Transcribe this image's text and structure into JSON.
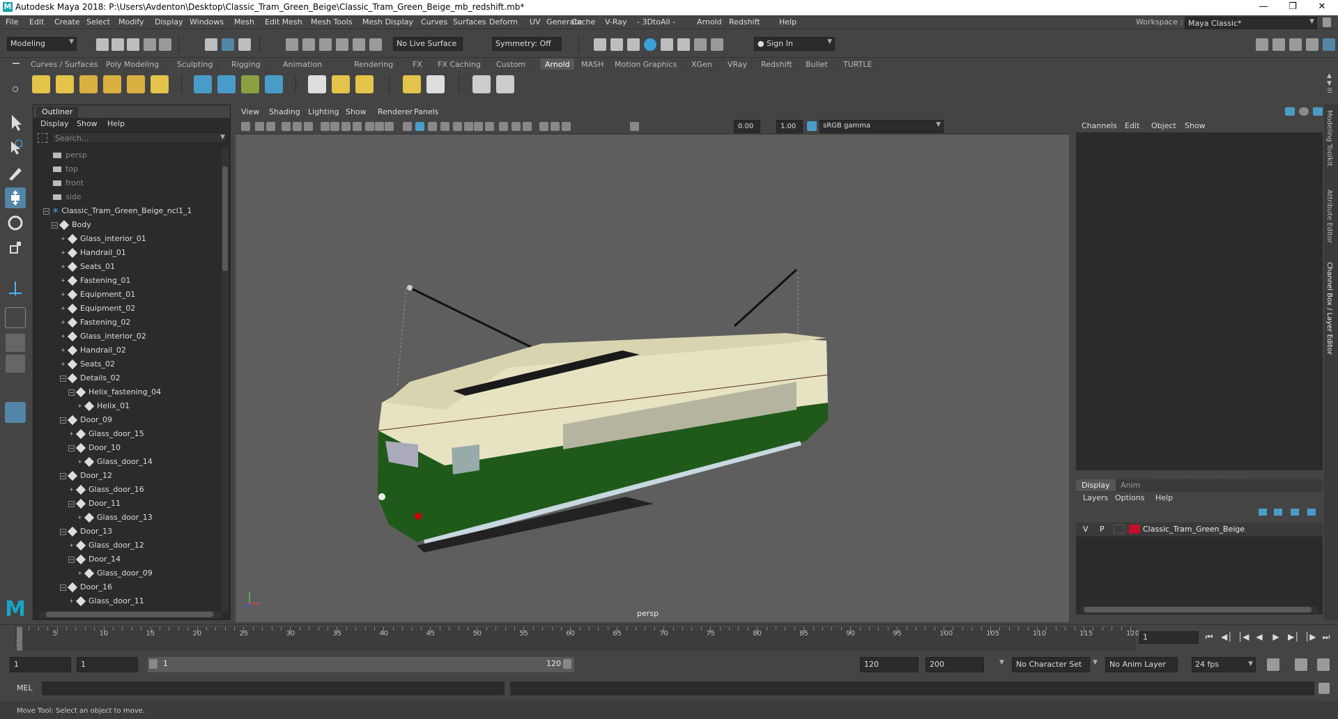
{
  "window": {
    "title": "Autodesk Maya 2018: P:\\Users\\Avdenton\\Desktop\\Classic_Tram_Green_Beige\\Classic_Tram_Green_Beige_mb_redshift.mb*",
    "logo": "M"
  },
  "menus": [
    "File",
    "Edit",
    "Create",
    "Select",
    "Modify",
    "Display",
    "Windows",
    "Mesh",
    "Edit Mesh",
    "Mesh Tools",
    "Mesh Display",
    "Curves",
    "Surfaces",
    "Deform",
    "UV",
    "Generate",
    "Cache",
    "V-Ray",
    "- 3DtoAll -",
    "Arnold",
    "Redshift",
    "Help"
  ],
  "workspace": {
    "label": "Workspace :",
    "value": "Maya Classic*"
  },
  "status": {
    "mode": "Modeling",
    "live_surface": "No Live Surface",
    "symmetry": "Symmetry: Off",
    "sign_in": "Sign In"
  },
  "shelf_tabs": [
    "Curves / Surfaces",
    "Poly Modeling",
    "Sculpting",
    "Rigging",
    "Animation",
    "Rendering",
    "FX",
    "FX Caching",
    "Custom",
    "Arnold",
    "MASH",
    "Motion Graphics",
    "XGen",
    "VRay",
    "Redshift",
    "Bullet",
    "TURTLE"
  ],
  "shelf_active": "Arnold",
  "outliner": {
    "tab": "Outliner",
    "menus": [
      "Display",
      "Show",
      "Help"
    ],
    "search_placeholder": "Search...",
    "rows": [
      {
        "label": "persp",
        "depth": 0,
        "kind": "cam",
        "dim": true
      },
      {
        "label": "top",
        "depth": 0,
        "kind": "cam",
        "dim": true
      },
      {
        "label": "front",
        "depth": 0,
        "kind": "cam",
        "dim": true
      },
      {
        "label": "side",
        "depth": 0,
        "kind": "cam",
        "dim": true
      },
      {
        "label": "Classic_Tram_Green_Beige_ncl1_1",
        "depth": 0,
        "kind": "grp",
        "exp": true
      },
      {
        "label": "Body",
        "depth": 1,
        "kind": "mesh",
        "exp": true
      },
      {
        "label": "Glass_interior_01",
        "depth": 2,
        "kind": "mesh"
      },
      {
        "label": "Handrail_01",
        "depth": 2,
        "kind": "mesh"
      },
      {
        "label": "Seats_01",
        "depth": 2,
        "kind": "mesh"
      },
      {
        "label": "Fastening_01",
        "depth": 2,
        "kind": "mesh"
      },
      {
        "label": "Equipment_01",
        "depth": 2,
        "kind": "mesh"
      },
      {
        "label": "Equipment_02",
        "depth": 2,
        "kind": "mesh"
      },
      {
        "label": "Fastening_02",
        "depth": 2,
        "kind": "mesh"
      },
      {
        "label": "Glass_interior_02",
        "depth": 2,
        "kind": "mesh"
      },
      {
        "label": "Handrail_02",
        "depth": 2,
        "kind": "mesh"
      },
      {
        "label": "Seats_02",
        "depth": 2,
        "kind": "mesh"
      },
      {
        "label": "Details_02",
        "depth": 2,
        "kind": "mesh",
        "exp": true
      },
      {
        "label": "Helix_fastening_04",
        "depth": 3,
        "kind": "mesh",
        "exp": true
      },
      {
        "label": "Helix_01",
        "depth": 4,
        "kind": "mesh"
      },
      {
        "label": "Door_09",
        "depth": 2,
        "kind": "mesh",
        "exp": true
      },
      {
        "label": "Glass_door_15",
        "depth": 3,
        "kind": "mesh"
      },
      {
        "label": "Door_10",
        "depth": 3,
        "kind": "mesh",
        "exp": true
      },
      {
        "label": "Glass_door_14",
        "depth": 4,
        "kind": "mesh"
      },
      {
        "label": "Door_12",
        "depth": 2,
        "kind": "mesh",
        "exp": true
      },
      {
        "label": "Glass_door_16",
        "depth": 3,
        "kind": "mesh"
      },
      {
        "label": "Door_11",
        "depth": 3,
        "kind": "mesh",
        "exp": true
      },
      {
        "label": "Glass_door_13",
        "depth": 4,
        "kind": "mesh"
      },
      {
        "label": "Door_13",
        "depth": 2,
        "kind": "mesh",
        "exp": true
      },
      {
        "label": "Glass_door_12",
        "depth": 3,
        "kind": "mesh"
      },
      {
        "label": "Door_14",
        "depth": 3,
        "kind": "mesh",
        "exp": true
      },
      {
        "label": "Glass_door_09",
        "depth": 4,
        "kind": "mesh"
      },
      {
        "label": "Door_16",
        "depth": 2,
        "kind": "mesh",
        "exp": true
      },
      {
        "label": "Glass_door_11",
        "depth": 3,
        "kind": "mesh"
      }
    ]
  },
  "viewport": {
    "menus": [
      "View",
      "Shading",
      "Lighting",
      "Show",
      "Renderer",
      "Panels"
    ],
    "exposure": "0.00",
    "gamma": "1.00",
    "color_space": "sRGB gamma",
    "camera_label": "persp"
  },
  "channel_box": {
    "menus": [
      "Channels",
      "Edit",
      "Object",
      "Show"
    ]
  },
  "layer_editor": {
    "tabs": [
      "Display",
      "Anim"
    ],
    "menus": [
      "Layers",
      "Options",
      "Help"
    ],
    "layer": {
      "v": "V",
      "p": "P",
      "name": "Classic_Tram_Green_Beige",
      "color": "#c4102a"
    }
  },
  "side_tabs": [
    "Modeling Toolkit",
    "Attribute Editor",
    "Channel Box / Layer Editor"
  ],
  "timeline": {
    "ticks": [
      1,
      5,
      10,
      15,
      20,
      25,
      30,
      35,
      40,
      45,
      50,
      55,
      60,
      65,
      70,
      75,
      80,
      85,
      90,
      95,
      100,
      105,
      110,
      115,
      120
    ],
    "current": "1"
  },
  "range": {
    "start": "1",
    "anim_start": "1",
    "range_start": "1",
    "range_end": "120",
    "end": "120",
    "anim_end": "200",
    "character": "No Character Set",
    "anim_layer": "No Anim Layer",
    "fps": "24 fps"
  },
  "cmd": {
    "label": "MEL"
  },
  "help": "Move Tool: Select an object to move.",
  "colors": {
    "accent": "#5285a6",
    "tram_green": "#1f5a1a",
    "tram_beige": "#e6e3c3"
  }
}
